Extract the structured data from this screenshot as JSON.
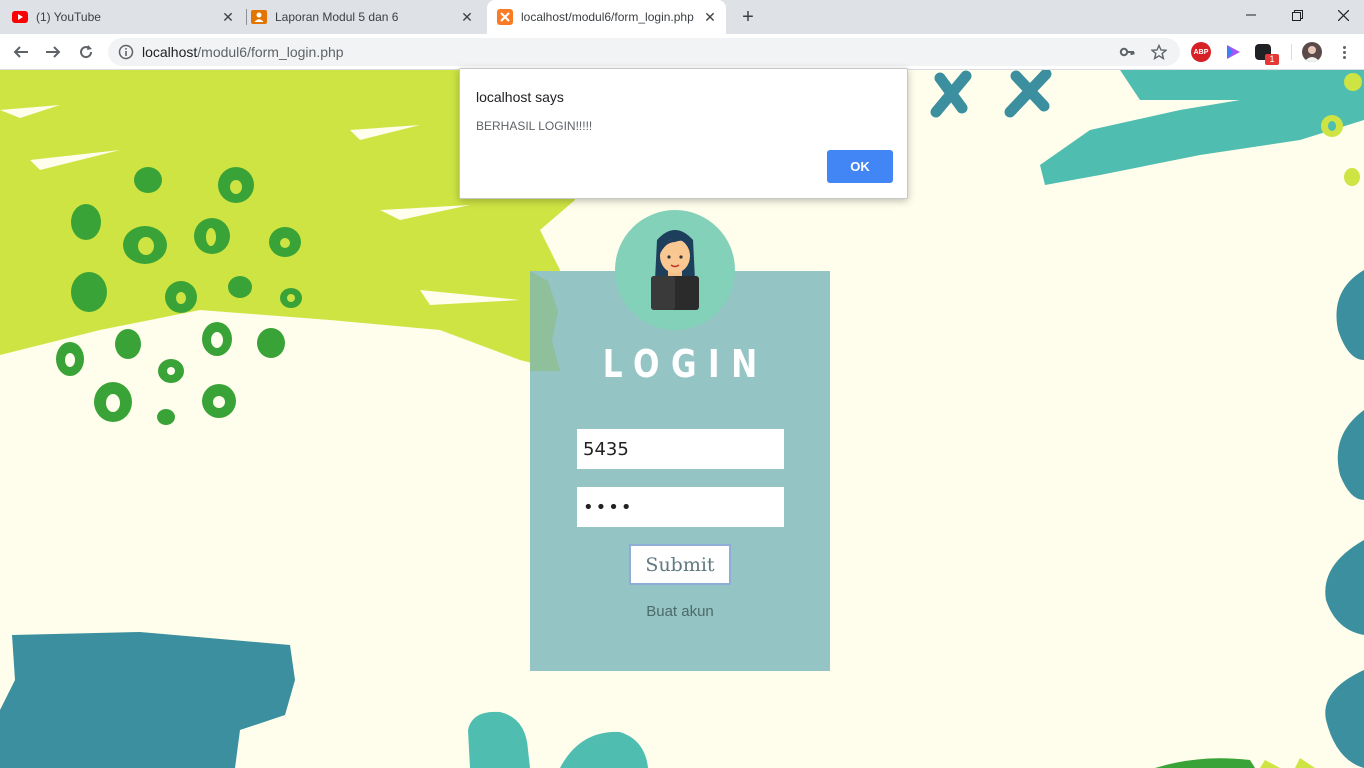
{
  "browser": {
    "tabs": [
      {
        "title": "(1) YouTube",
        "icon": "youtube-icon",
        "active": false
      },
      {
        "title": "Laporan Modul 5 dan 6",
        "icon": "classroom-icon",
        "active": false
      },
      {
        "title": "localhost/modul6/form_login.php",
        "icon": "xampp-icon",
        "active": true
      }
    ],
    "url_host": "localhost",
    "url_path": "/modul6/form_login.php",
    "extension_badge": "1",
    "abp_label": "ABP"
  },
  "dialog": {
    "title": "localhost says",
    "message": "BERHASIL LOGIN!!!!!",
    "ok_label": "OK"
  },
  "login": {
    "heading": "LOGIN",
    "username_value": "5435",
    "password_mask": "••••",
    "submit_label": "Submit",
    "create_account_label": "Buat akun"
  },
  "colors": {
    "card": "#95c4c4",
    "avatar_bg": "#82d1b8",
    "lime": "#cde443",
    "green_dots": "#3aa337",
    "teal": "#3b8f9e",
    "aqua": "#4fbdb0",
    "ok_button": "#4285f4"
  }
}
